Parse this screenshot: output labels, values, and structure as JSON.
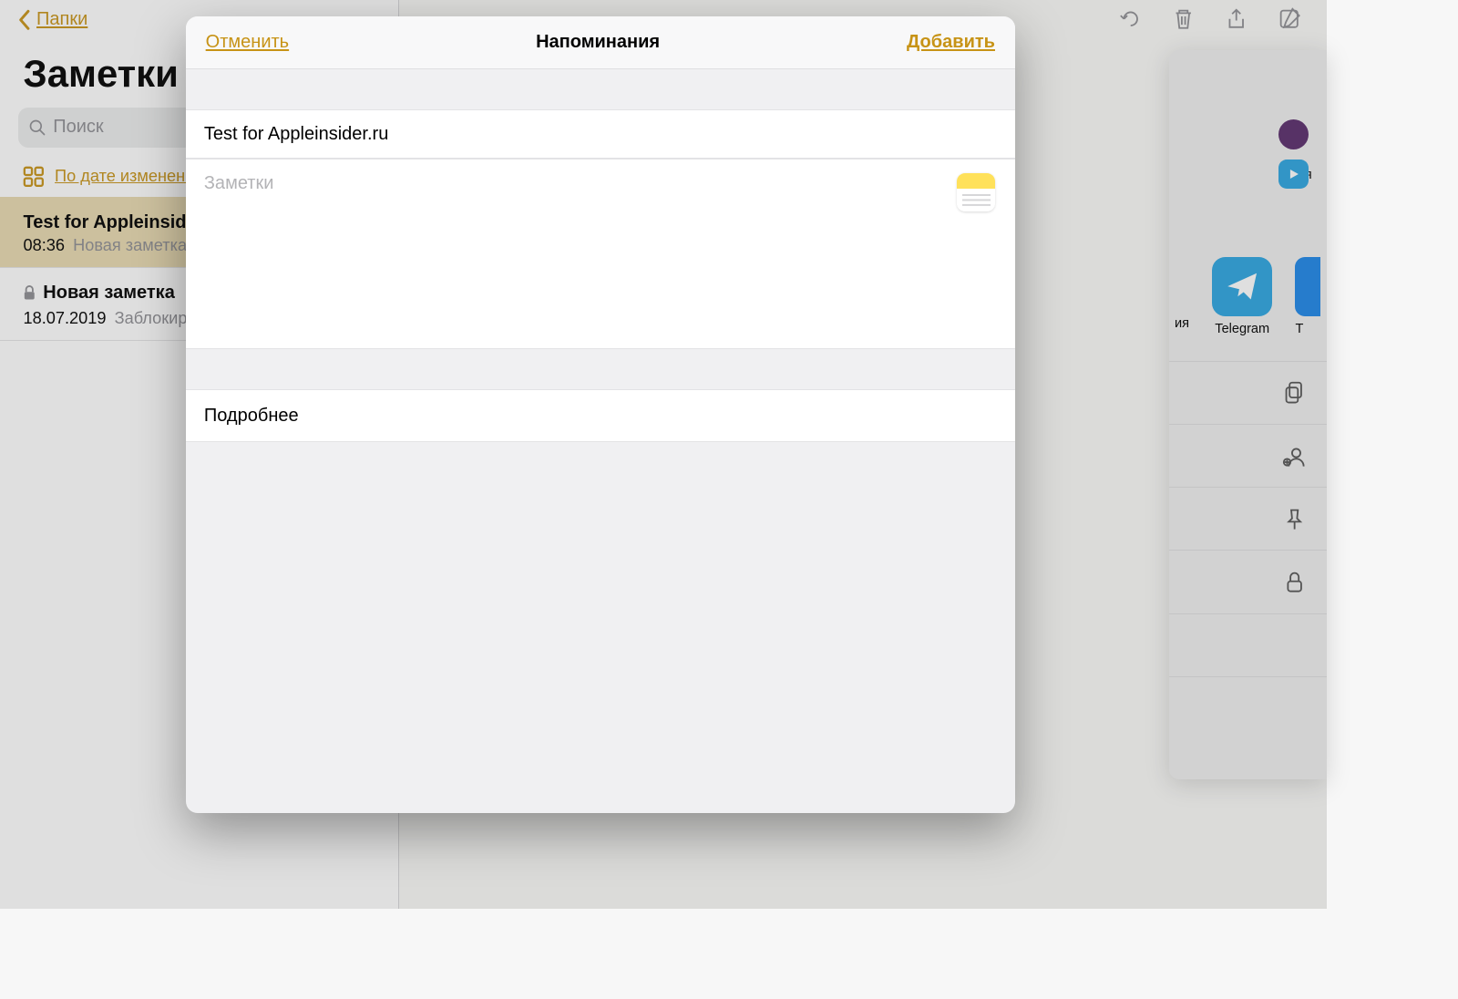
{
  "sidebar": {
    "back_label": "Папки",
    "title": "Заметки",
    "search_placeholder": "Поиск",
    "sort_label": "По дате изменения",
    "notes": [
      {
        "title": "Test for Appleinsider.ru",
        "time": "08:36",
        "subtitle": "Новая заметка",
        "locked": false,
        "active": true
      },
      {
        "title": "Новая заметка",
        "time": "18.07.2019",
        "subtitle": "Заблокировано",
        "locked": true,
        "active": false
      }
    ]
  },
  "share": {
    "row1_suffix": "я",
    "row2_suffix": "ия",
    "telegram_label": "Telegram",
    "t_label": "T"
  },
  "modal": {
    "cancel": "Отменить",
    "title": "Напоминания",
    "add": "Добавить",
    "reminder_text": "Test for Appleinsider.ru",
    "notes_placeholder": "Заметки",
    "more": "Подробнее"
  }
}
